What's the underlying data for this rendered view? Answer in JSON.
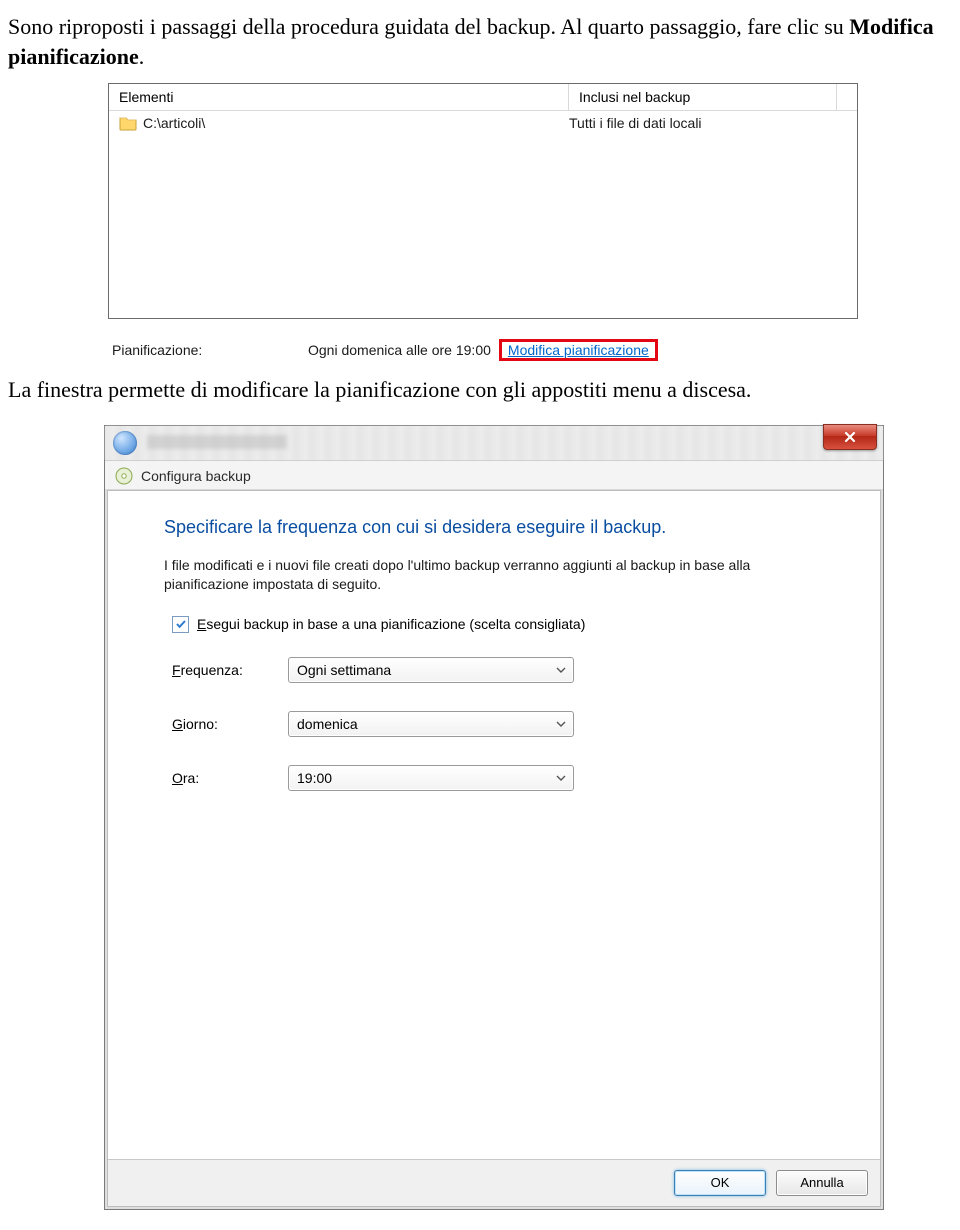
{
  "para1_a": "Sono riproposti i passaggi della procedura guidata del backup. Al quarto passaggio, fare clic su ",
  "para1_bold": "Modifica pianificazione",
  "para1_b": ".",
  "shot1": {
    "col_left": "Elementi",
    "col_right": "Inclusi nel backup",
    "row_path": "C:\\articoli\\",
    "row_desc": "Tutti i file di dati locali",
    "sched_label": "Pianificazione:",
    "sched_value": "Ogni domenica alle ore 19:00",
    "sched_link": "Modifica pianificazione"
  },
  "para2": "La finestra permette di modificare la pianificazione con gli appostiti menu a discesa.",
  "shot2": {
    "subhead": "Configura backup",
    "heading": "Specificare la frequenza con cui si desidera eseguire il backup.",
    "desc": "I file modificati e i nuovi file creati dopo l'ultimo backup verranno aggiunti al backup in base alla pianificazione impostata di seguito.",
    "chk_pre": "E",
    "chk_rest": "segui backup in base a una pianificazione (scelta consigliata)",
    "freq_pre": "F",
    "freq_rest": "requenza:",
    "freq_val": "Ogni settimana",
    "day_pre": "G",
    "day_rest": "iorno:",
    "day_val": "domenica",
    "hour_pre": "O",
    "hour_rest": "ra:",
    "hour_val": "19:00",
    "ok": "OK",
    "cancel": "Annulla"
  }
}
